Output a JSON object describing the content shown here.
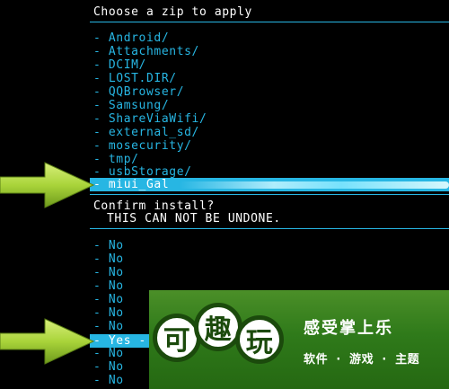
{
  "header_title": "Choose a zip to apply",
  "folders": [
    "- Android/",
    "- Attachments/",
    "- DCIM/",
    "- LOST.DIR/",
    "- QQBrowser/",
    "- Samsung/",
    "- ShareViaWifi/",
    "- external_sd/",
    "- mosecurity/",
    "- tmp/",
    "- usbStorage/"
  ],
  "selected_file": "- miui_Gal",
  "confirm": {
    "title": "Confirm install?",
    "warning": "THIS CAN NOT BE UNDONE.",
    "options_before": [
      "- No",
      "- No",
      "- No",
      "- No",
      "- No",
      "- No",
      "- No"
    ],
    "selected_option": "- Yes -",
    "options_after": [
      "- No",
      "- No",
      "- No"
    ]
  },
  "ad": {
    "logo_chars": [
      "可",
      "趣",
      "玩"
    ],
    "slogan": "感受掌上乐",
    "tags": [
      "软件",
      "·",
      "游戏",
      "·",
      "主题"
    ]
  },
  "colors": {
    "highlight": "#27b6e3",
    "arrow": "#9acd32",
    "ad_green": "#2f7a1a"
  }
}
